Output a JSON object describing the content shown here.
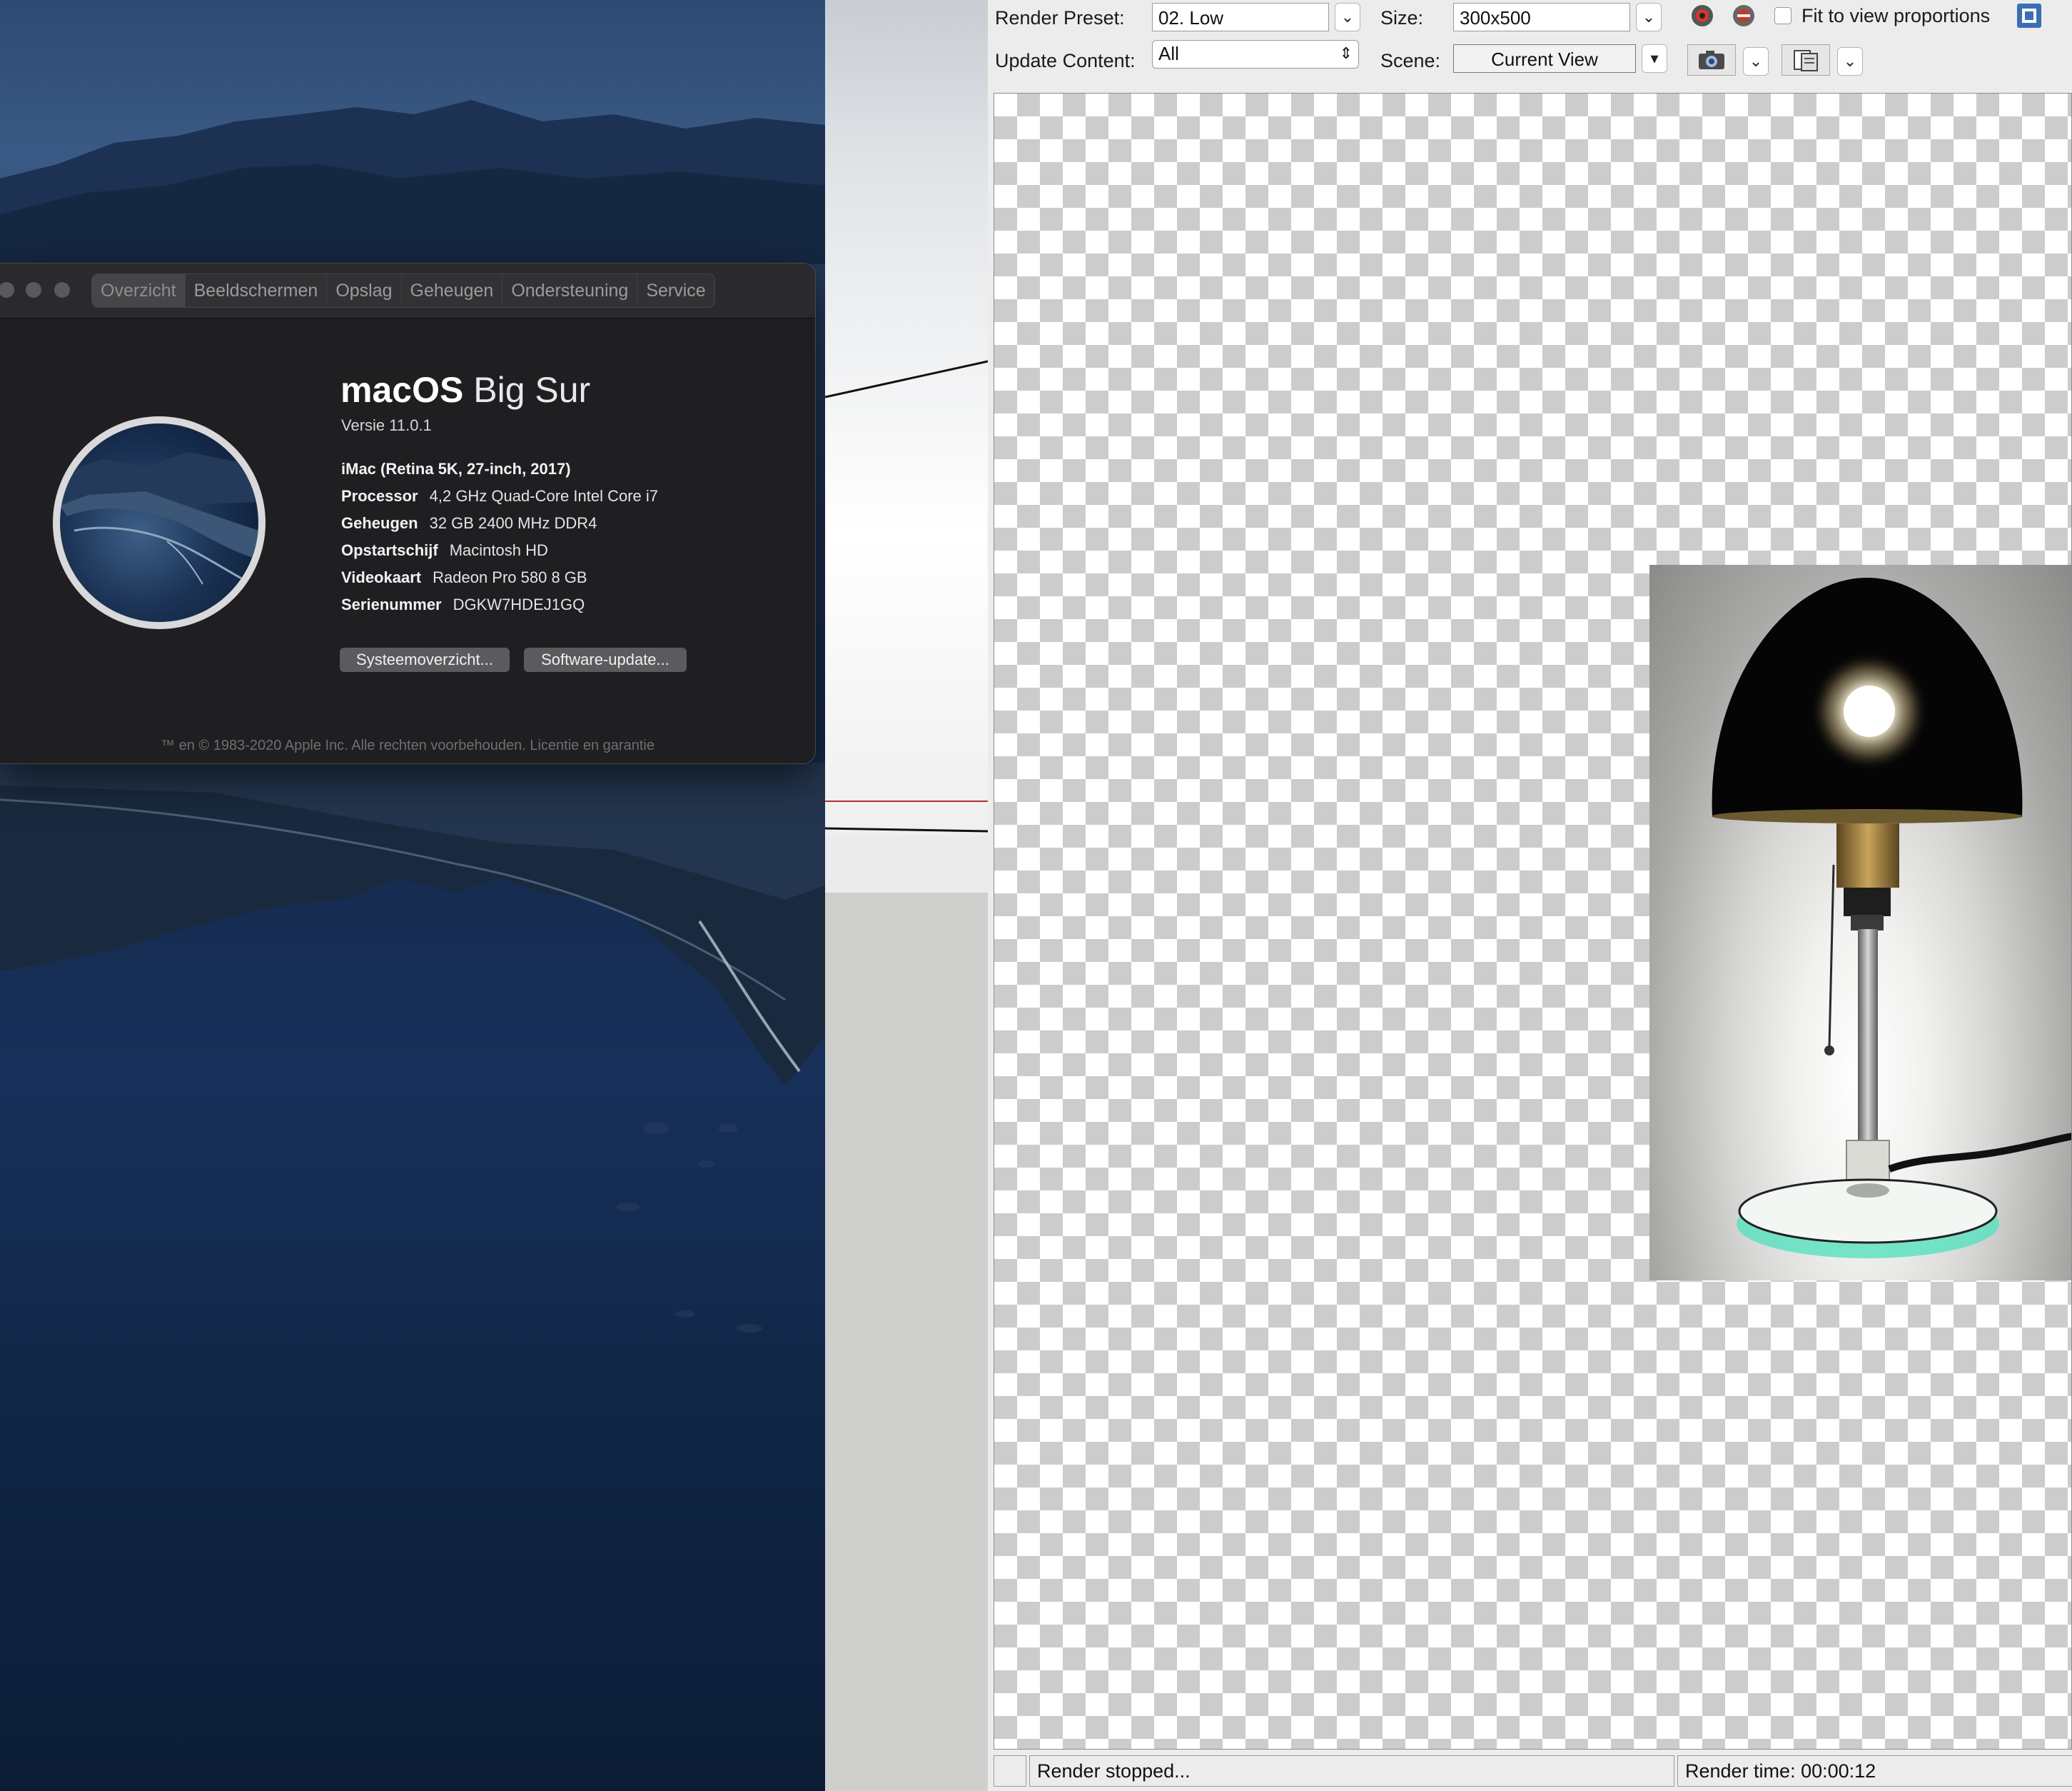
{
  "about_window": {
    "tabs": [
      {
        "label": "Overzicht"
      },
      {
        "label": "Beeldschermen"
      },
      {
        "label": "Opslag"
      },
      {
        "label": "Geheugen"
      },
      {
        "label": "Ondersteuning"
      },
      {
        "label": "Service"
      }
    ],
    "os_name_bold": "macOS",
    "os_name_light": "Big Sur",
    "version": "Versie 11.0.1",
    "model": "iMac (Retina 5K, 27-inch, 2017)",
    "specs": [
      {
        "key": "Processor",
        "value": "4,2 GHz Quad-Core Intel Core i7"
      },
      {
        "key": "Geheugen",
        "value": "32 GB 2400 MHz DDR4"
      },
      {
        "key": "Opstartschijf",
        "value": "Macintosh HD"
      },
      {
        "key": "Videokaart",
        "value": "Radeon Pro 580 8 GB"
      },
      {
        "key": "Serienummer",
        "value": "DGKW7HDEJ1GQ"
      }
    ],
    "buttons": {
      "system_report": "Systeemoverzicht...",
      "software_update": "Software-update..."
    },
    "footer": "™ en © 1983-2020 Apple Inc. Alle rechten voorbehouden. Licentie en garantie"
  },
  "render_window": {
    "render_preset_label": "Render Preset:",
    "render_preset_value": "02. Low",
    "size_label": "Size:",
    "size_value": "300x500",
    "fit_label": "Fit to view proportions",
    "update_content_label": "Update Content:",
    "update_content_value": "All",
    "scene_label": "Scene:",
    "scene_value": "Current View",
    "status": "Render stopped...",
    "render_time": "Render time: 00:00:12"
  },
  "colors": {
    "canvas_checker": "#cccccc",
    "render_glass_base": "#5fe0c0",
    "about_bg": "#1f1f21"
  },
  "icons": [
    "render-start-icon",
    "render-stop-icon",
    "camera-icon",
    "copy-icon",
    "fit-view-icon",
    "dropdown-arrow-icon"
  ]
}
